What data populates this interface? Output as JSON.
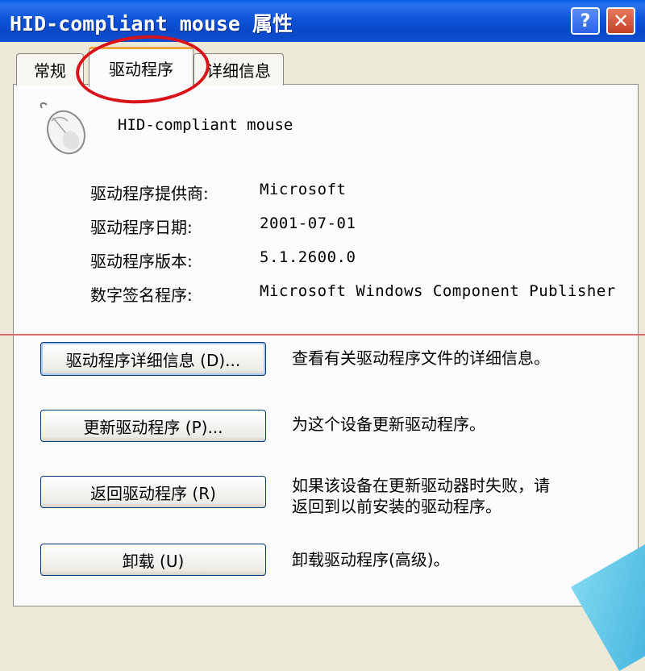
{
  "window": {
    "title": "HID-compliant mouse 属性",
    "help_symbol": "?",
    "close_symbol": "✕"
  },
  "tabs": [
    {
      "label": "常规"
    },
    {
      "label": "驱动程序"
    },
    {
      "label": "详细信息"
    }
  ],
  "device": {
    "name": "HID-compliant mouse",
    "icon": "mouse-icon"
  },
  "driver_info": [
    {
      "label": "驱动程序提供商:",
      "value": "Microsoft"
    },
    {
      "label": "驱动程序日期:",
      "value": "2001-07-01"
    },
    {
      "label": "驱动程序版本:",
      "value": "5.1.2600.0"
    },
    {
      "label": "数字签名程序:",
      "value": "Microsoft Windows Component Publisher"
    }
  ],
  "actions": [
    {
      "button": "驱动程序详细信息 (D)...",
      "description": "查看有关驱动程序文件的详细信息。"
    },
    {
      "button": "更新驱动程序 (P)...",
      "description": "为这个设备更新驱动程序。"
    },
    {
      "button": "返回驱动程序 (R)",
      "description_line1": "如果该设备在更新驱动器时失败，请",
      "description_line2": "返回到以前安装的驱动程序。"
    },
    {
      "button": "卸载 (U)",
      "description": "卸载驱动程序(高级)。"
    }
  ],
  "colors": {
    "titlebar": "#0d54d8",
    "highlight": "#d8141a",
    "dialog_bg": "#ece9d8"
  }
}
